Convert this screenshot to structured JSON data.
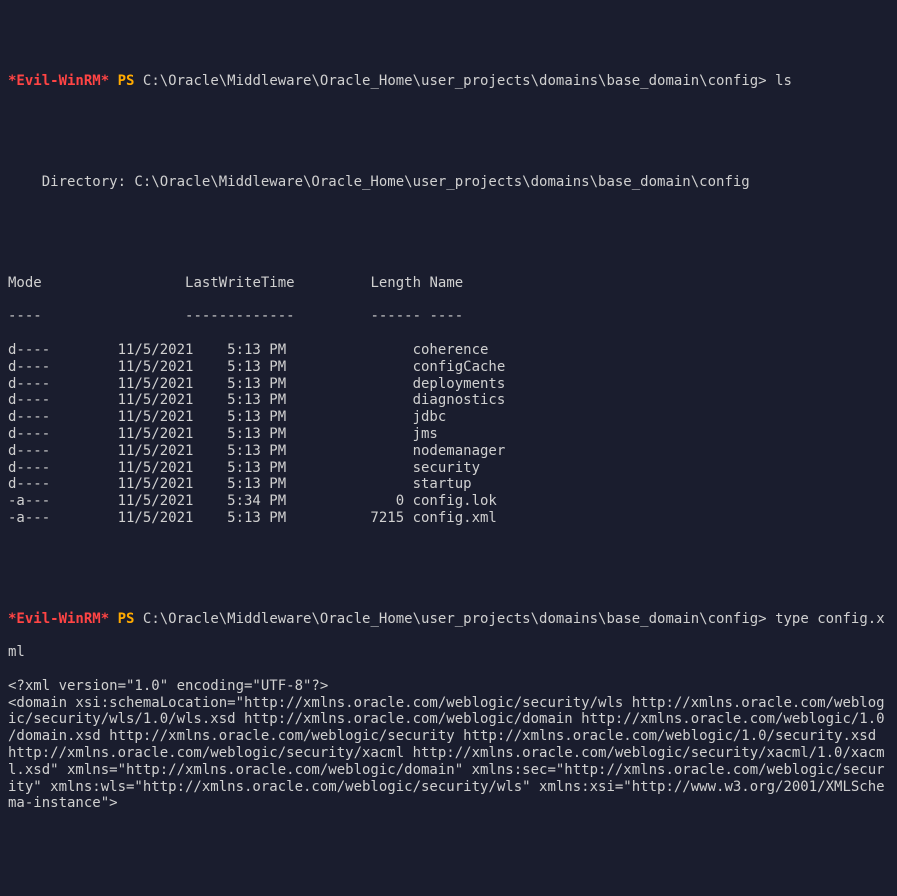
{
  "prompt1": {
    "star": "*Evil-WinRM*",
    "ps": "PS",
    "path": "C:\\Oracle\\Middleware\\Oracle_Home\\user_projects\\domains\\base_domain\\config>",
    "command": "ls"
  },
  "dir_header": "    Directory: C:\\Oracle\\Middleware\\Oracle_Home\\user_projects\\domains\\base_domain\\config",
  "table_headers": {
    "mode": "Mode",
    "lwt": "LastWriteTime",
    "length": "Length",
    "name": "Name"
  },
  "table_divider": {
    "mode": "----",
    "lwt": "-------------",
    "length": "------",
    "name": "----"
  },
  "rows": [
    {
      "mode": "d----",
      "date": "11/5/2021",
      "time": "5:13 PM",
      "length": "",
      "name": "coherence"
    },
    {
      "mode": "d----",
      "date": "11/5/2021",
      "time": "5:13 PM",
      "length": "",
      "name": "configCache"
    },
    {
      "mode": "d----",
      "date": "11/5/2021",
      "time": "5:13 PM",
      "length": "",
      "name": "deployments"
    },
    {
      "mode": "d----",
      "date": "11/5/2021",
      "time": "5:13 PM",
      "length": "",
      "name": "diagnostics"
    },
    {
      "mode": "d----",
      "date": "11/5/2021",
      "time": "5:13 PM",
      "length": "",
      "name": "jdbc"
    },
    {
      "mode": "d----",
      "date": "11/5/2021",
      "time": "5:13 PM",
      "length": "",
      "name": "jms"
    },
    {
      "mode": "d----",
      "date": "11/5/2021",
      "time": "5:13 PM",
      "length": "",
      "name": "nodemanager"
    },
    {
      "mode": "d----",
      "date": "11/5/2021",
      "time": "5:13 PM",
      "length": "",
      "name": "security"
    },
    {
      "mode": "d----",
      "date": "11/5/2021",
      "time": "5:13 PM",
      "length": "",
      "name": "startup"
    },
    {
      "mode": "-a---",
      "date": "11/5/2021",
      "time": "5:34 PM",
      "length": "0",
      "name": "config.lok"
    },
    {
      "mode": "-a---",
      "date": "11/5/2021",
      "time": "5:13 PM",
      "length": "7215",
      "name": "config.xml"
    }
  ],
  "prompt2": {
    "star": "*Evil-WinRM*",
    "ps": "PS",
    "path": "C:\\Oracle\\Middleware\\Oracle_Home\\user_projects\\domains\\base_domain\\config>",
    "command": "type config.x"
  },
  "prompt2_cont": "ml",
  "xml_lines": [
    "<?xml version=\"1.0\" encoding=\"UTF-8\"?>",
    "<domain xsi:schemaLocation=\"http://xmlns.oracle.com/weblogic/security/wls http://xmlns.oracle.com/weblog",
    "ic/security/wls/1.0/wls.xsd http://xmlns.oracle.com/weblogic/domain http://xmlns.oracle.com/weblogic/1.0",
    "/domain.xsd http://xmlns.oracle.com/weblogic/security http://xmlns.oracle.com/weblogic/1.0/security.xsd ",
    "http://xmlns.oracle.com/weblogic/security/xacml http://xmlns.oracle.com/weblogic/security/xacml/1.0/xacm",
    "l.xsd\" xmlns=\"http://xmlns.oracle.com/weblogic/domain\" xmlns:sec=\"http://xmlns.oracle.com/weblogic/secur",
    "ity\" xmlns:wls=\"http://xmlns.oracle.com/weblogic/security/wls\" xmlns:xsi=\"http://www.w3.org/2001/XMLSche",
    "ma-instance\">"
  ]
}
